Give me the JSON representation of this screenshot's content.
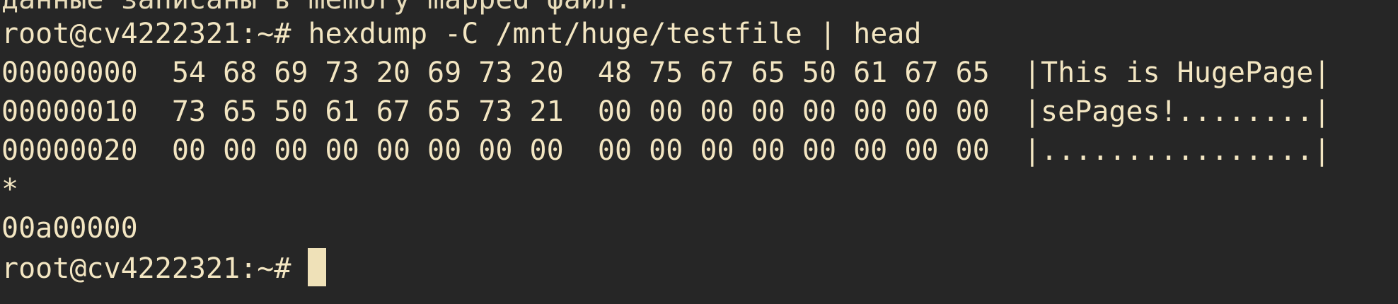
{
  "terminal": {
    "prompt": "root@cv4222321:~# ",
    "partial_line": "данные записаны в memory mapped файл.",
    "command": "hexdump -C /mnt/huge/testfile | head",
    "output": [
      "00000000  54 68 69 73 20 69 73 20  48 75 67 65 50 61 67 65  |This is HugePage|",
      "00000010  73 65 50 61 67 65 73 21  00 00 00 00 00 00 00 00  |sePages!........|",
      "00000020  00 00 00 00 00 00 00 00  00 00 00 00 00 00 00 00  |................|",
      "*",
      "00a00000"
    ]
  },
  "colors": {
    "background": "#262626",
    "foreground": "#f3e6c2",
    "cursor": "#efe1b8"
  }
}
